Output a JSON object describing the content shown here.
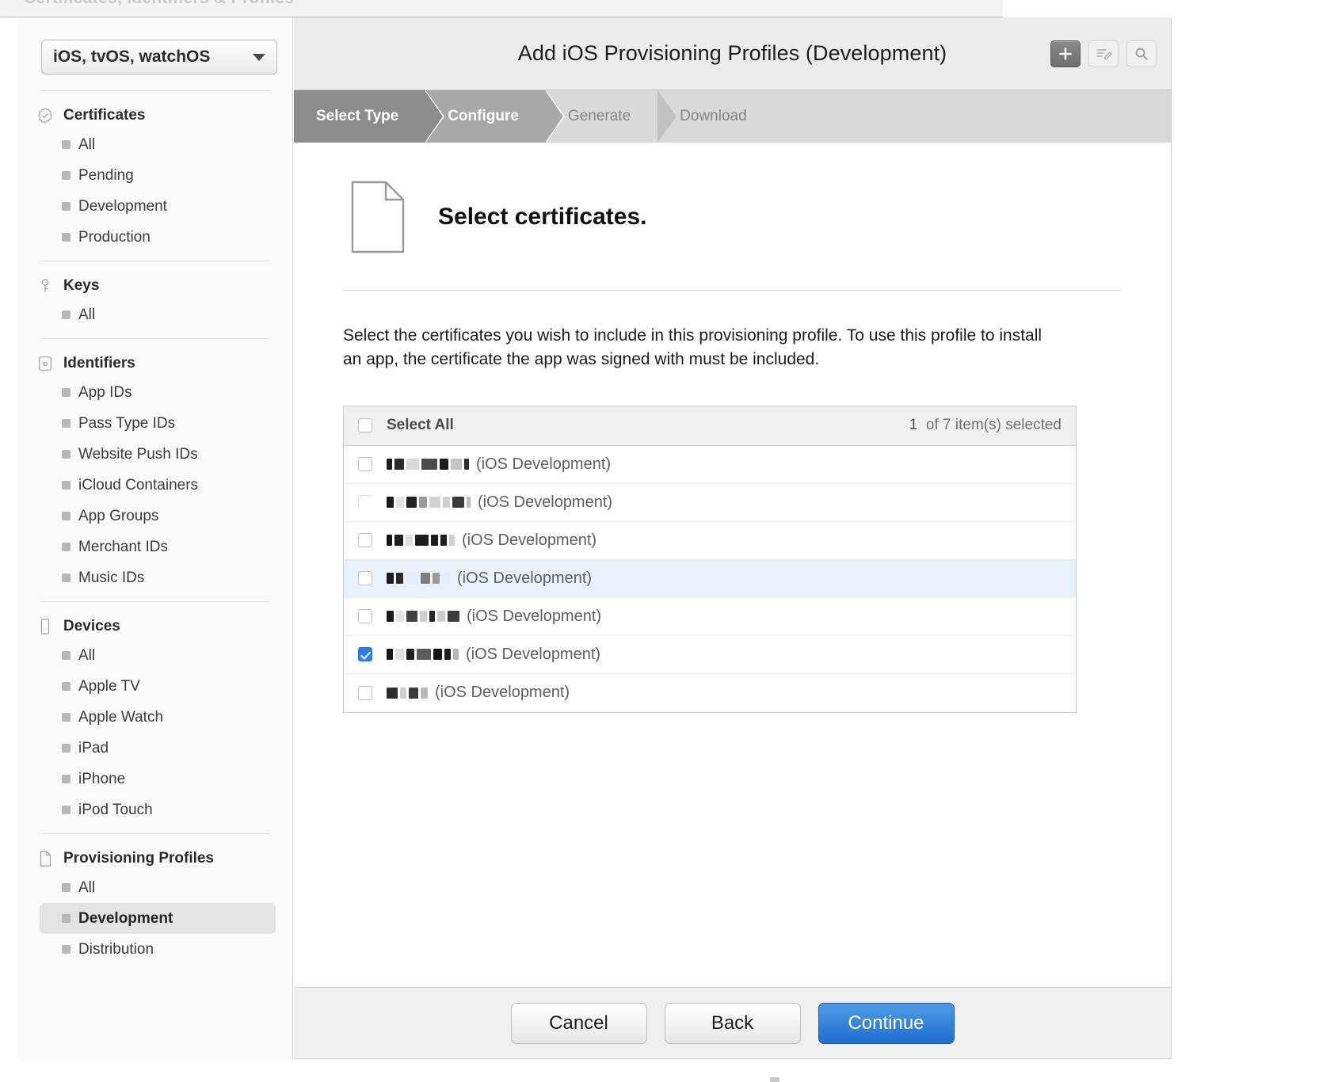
{
  "window": {
    "ghost_title": "Certificates, Identifiers & Profiles"
  },
  "sidebar": {
    "os_selector": {
      "value": "iOS, tvOS, watchOS",
      "caret_icon": "chevron-down-icon"
    },
    "groups": [
      {
        "id": "certificates",
        "label": "Certificates",
        "icon": "certificate-seal-icon",
        "items": [
          {
            "label": "All",
            "active": false
          },
          {
            "label": "Pending",
            "active": false
          },
          {
            "label": "Development",
            "active": false
          },
          {
            "label": "Production",
            "active": false
          }
        ]
      },
      {
        "id": "keys",
        "label": "Keys",
        "icon": "key-icon",
        "items": [
          {
            "label": "All",
            "active": false
          }
        ]
      },
      {
        "id": "identifiers",
        "label": "Identifiers",
        "icon": "id-badge-icon",
        "items": [
          {
            "label": "App IDs",
            "active": false
          },
          {
            "label": "Pass Type IDs",
            "active": false
          },
          {
            "label": "Website Push IDs",
            "active": false
          },
          {
            "label": "iCloud Containers",
            "active": false
          },
          {
            "label": "App Groups",
            "active": false
          },
          {
            "label": "Merchant IDs",
            "active": false
          },
          {
            "label": "Music IDs",
            "active": false
          }
        ]
      },
      {
        "id": "devices",
        "label": "Devices",
        "icon": "device-phone-icon",
        "items": [
          {
            "label": "All",
            "active": false
          },
          {
            "label": "Apple TV",
            "active": false
          },
          {
            "label": "Apple Watch",
            "active": false
          },
          {
            "label": "iPad",
            "active": false
          },
          {
            "label": "iPhone",
            "active": false
          },
          {
            "label": "iPod Touch",
            "active": false
          }
        ]
      },
      {
        "id": "provisioning-profiles",
        "label": "Provisioning Profiles",
        "icon": "document-icon",
        "items": [
          {
            "label": "All",
            "active": false
          },
          {
            "label": "Development",
            "active": true
          },
          {
            "label": "Distribution",
            "active": false
          }
        ]
      }
    ]
  },
  "header": {
    "title": "Add iOS Provisioning Profiles (Development)",
    "tools": [
      {
        "name": "add-button",
        "icon": "plus-icon",
        "state": "primary"
      },
      {
        "name": "edit-button",
        "icon": "edit-pencil-icon",
        "state": "ghost"
      },
      {
        "name": "search-button",
        "icon": "search-icon",
        "state": "ghost"
      }
    ]
  },
  "steps": [
    {
      "label": "Select Type",
      "state": "done"
    },
    {
      "label": "Configure",
      "state": "current"
    },
    {
      "label": "Generate",
      "state": "todo"
    },
    {
      "label": "Download",
      "state": "todo"
    }
  ],
  "content": {
    "icon": "document-icon",
    "title": "Select certificates.",
    "paragraph": "Select the certificates you wish to include in this provisioning profile. To use this profile to install an app, the certificate the app was signed with must be included."
  },
  "certificate_list": {
    "select_all_label": "Select All",
    "count_selected": "1",
    "count_text": "of 7 item(s) selected",
    "suffix": "(iOS Development)",
    "rows": [
      {
        "checked": false,
        "highlight": false,
        "redacted": true,
        "suffix": "(iOS Development)"
      },
      {
        "checked": false,
        "highlight": false,
        "redacted": true,
        "suffix": "(iOS Development)"
      },
      {
        "checked": false,
        "highlight": false,
        "redacted": true,
        "suffix": "(iOS Development)"
      },
      {
        "checked": false,
        "highlight": true,
        "redacted": true,
        "suffix": "(iOS Development)"
      },
      {
        "checked": false,
        "highlight": false,
        "redacted": true,
        "suffix": "(iOS Development)"
      },
      {
        "checked": true,
        "highlight": false,
        "redacted": true,
        "suffix": "(iOS Development)"
      },
      {
        "checked": false,
        "highlight": false,
        "redacted": true,
        "suffix": "(iOS Development)"
      }
    ]
  },
  "footer": {
    "cancel_label": "Cancel",
    "back_label": "Back",
    "continue_label": "Continue"
  },
  "colors": {
    "accent_blue": "#2c7ef0",
    "primary_button": "#1e6fd0",
    "row_highlight": "#e8f2fb",
    "step_done": "#8c8c8c",
    "step_current": "#a8a8a8",
    "step_todo": "#d9d9d9"
  }
}
